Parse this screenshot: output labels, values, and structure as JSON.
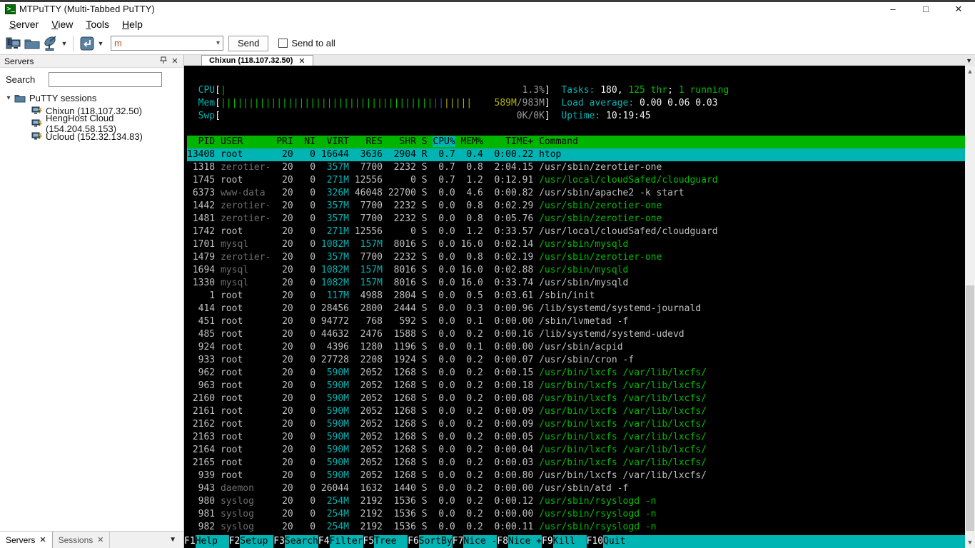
{
  "window": {
    "title": "MTPuTTY (Multi-Tabbed PuTTY)"
  },
  "menu": {
    "items": [
      "Server",
      "View",
      "Tools",
      "Help"
    ]
  },
  "toolbar": {
    "command_value": "m",
    "send_label": "Send",
    "send_to_all_label": "Send to all"
  },
  "sidebar": {
    "panel_title": "Servers",
    "search_label": "Search",
    "tree_root": "PuTTY sessions",
    "sessions": [
      "Chixun (118.107.32.50)",
      "HengHost Cloud (154.204.58.153)",
      "Ucloud (152.32.134.83)"
    ],
    "bottom_tabs": [
      "Servers",
      "Sessions"
    ]
  },
  "tabbar": {
    "active_tab": "Chixun (118.107.32.50)"
  },
  "terminal": {
    "colors": {
      "background": "#000000",
      "green": "#00b400",
      "cyan": "#00b4b4",
      "yellow": "#b4b400",
      "blue": "#4646dc",
      "text": "#c0c0c0",
      "dim_text": "#6e6e6e"
    },
    "cpu": {
      "label": "CPU",
      "ticks_green": 1,
      "pct": "1.3%"
    },
    "mem": {
      "label": "Mem",
      "ticks_green": 38,
      "ticks_blue": 2,
      "ticks_yellow": 5,
      "used": "589M",
      "total": "983M"
    },
    "swp": {
      "label": "Swp",
      "used": "0K",
      "total": "0K"
    },
    "tasks": {
      "label": "Tasks: ",
      "count": "180, ",
      "threads": "125 thr",
      "sep": "; ",
      "running": "1 running"
    },
    "load": {
      "label": "Load average: ",
      "values": "0.00 0.06 0.03"
    },
    "uptime": {
      "label": "Uptime: ",
      "value": "10:19:45"
    },
    "table": {
      "columns": [
        "PID",
        "USER",
        "PRI",
        "NI",
        "VIRT",
        "RES",
        "SHR",
        "S",
        "CPU%",
        "MEM%",
        "TIME+",
        "Command"
      ],
      "sort_column": "CPU%",
      "rows": [
        {
          "pid": "13408",
          "user": "root",
          "pri": "20",
          "ni": "0",
          "virt": "16644",
          "res": "3636",
          "shr": "2904",
          "s": "R",
          "cpu": "0.7",
          "mem": "0.4",
          "time": "0:00.22",
          "cmd": "htop",
          "selected": true,
          "thread": false
        },
        {
          "pid": "1318",
          "user": "zerotier-",
          "pri": "20",
          "ni": "0",
          "virt": "357M",
          "res": "7700",
          "shr": "2232",
          "s": "S",
          "cpu": "0.7",
          "mem": "0.8",
          "time": "2:04.15",
          "cmd": "/usr/sbin/zerotier-one",
          "thread": false
        },
        {
          "pid": "1745",
          "user": "root",
          "pri": "20",
          "ni": "0",
          "virt": "271M",
          "res": "12556",
          "shr": "0",
          "s": "S",
          "cpu": "0.7",
          "mem": "1.2",
          "time": "0:12.91",
          "cmd": "/usr/local/cloudSafed/cloudguard",
          "thread": true
        },
        {
          "pid": "6373",
          "user": "www-data",
          "pri": "20",
          "ni": "0",
          "virt": "326M",
          "res": "46048",
          "shr": "22700",
          "s": "S",
          "cpu": "0.0",
          "mem": "4.6",
          "time": "0:00.82",
          "cmd": "/usr/sbin/apache2 -k start",
          "thread": false
        },
        {
          "pid": "1442",
          "user": "zerotier-",
          "pri": "20",
          "ni": "0",
          "virt": "357M",
          "res": "7700",
          "shr": "2232",
          "s": "S",
          "cpu": "0.0",
          "mem": "0.8",
          "time": "0:02.29",
          "cmd": "/usr/sbin/zerotier-one",
          "thread": true
        },
        {
          "pid": "1481",
          "user": "zerotier-",
          "pri": "20",
          "ni": "0",
          "virt": "357M",
          "res": "7700",
          "shr": "2232",
          "s": "S",
          "cpu": "0.0",
          "mem": "0.8",
          "time": "0:05.76",
          "cmd": "/usr/sbin/zerotier-one",
          "thread": true
        },
        {
          "pid": "1742",
          "user": "root",
          "pri": "20",
          "ni": "0",
          "virt": "271M",
          "res": "12556",
          "shr": "0",
          "s": "S",
          "cpu": "0.0",
          "mem": "1.2",
          "time": "0:33.57",
          "cmd": "/usr/local/cloudSafed/cloudguard",
          "thread": false
        },
        {
          "pid": "1701",
          "user": "mysql",
          "pri": "20",
          "ni": "0",
          "virt": "1082M",
          "res": "157M",
          "shr": "8016",
          "s": "S",
          "cpu": "0.0",
          "mem": "16.0",
          "time": "0:02.14",
          "cmd": "/usr/sbin/mysqld",
          "thread": true
        },
        {
          "pid": "1479",
          "user": "zerotier-",
          "pri": "20",
          "ni": "0",
          "virt": "357M",
          "res": "7700",
          "shr": "2232",
          "s": "S",
          "cpu": "0.0",
          "mem": "0.8",
          "time": "0:02.19",
          "cmd": "/usr/sbin/zerotier-one",
          "thread": true
        },
        {
          "pid": "1694",
          "user": "mysql",
          "pri": "20",
          "ni": "0",
          "virt": "1082M",
          "res": "157M",
          "shr": "8016",
          "s": "S",
          "cpu": "0.0",
          "mem": "16.0",
          "time": "0:02.88",
          "cmd": "/usr/sbin/mysqld",
          "thread": true
        },
        {
          "pid": "1330",
          "user": "mysql",
          "pri": "20",
          "ni": "0",
          "virt": "1082M",
          "res": "157M",
          "shr": "8016",
          "s": "S",
          "cpu": "0.0",
          "mem": "16.0",
          "time": "0:33.74",
          "cmd": "/usr/sbin/mysqld",
          "thread": false
        },
        {
          "pid": "1",
          "user": "root",
          "pri": "20",
          "ni": "0",
          "virt": "117M",
          "res": "4988",
          "shr": "2804",
          "s": "S",
          "cpu": "0.0",
          "mem": "0.5",
          "time": "0:03.61",
          "cmd": "/sbin/init",
          "thread": false
        },
        {
          "pid": "414",
          "user": "root",
          "pri": "20",
          "ni": "0",
          "virt": "28456",
          "res": "2800",
          "shr": "2444",
          "s": "S",
          "cpu": "0.0",
          "mem": "0.3",
          "time": "0:00.96",
          "cmd": "/lib/systemd/systemd-journald",
          "thread": false
        },
        {
          "pid": "451",
          "user": "root",
          "pri": "20",
          "ni": "0",
          "virt": "94772",
          "res": "768",
          "shr": "592",
          "s": "S",
          "cpu": "0.0",
          "mem": "0.1",
          "time": "0:00.00",
          "cmd": "/sbin/lvmetad -f",
          "thread": false
        },
        {
          "pid": "485",
          "user": "root",
          "pri": "20",
          "ni": "0",
          "virt": "44632",
          "res": "2476",
          "shr": "1588",
          "s": "S",
          "cpu": "0.0",
          "mem": "0.2",
          "time": "0:00.16",
          "cmd": "/lib/systemd/systemd-udevd",
          "thread": false
        },
        {
          "pid": "924",
          "user": "root",
          "pri": "20",
          "ni": "0",
          "virt": "4396",
          "res": "1280",
          "shr": "1196",
          "s": "S",
          "cpu": "0.0",
          "mem": "0.1",
          "time": "0:00.00",
          "cmd": "/usr/sbin/acpid",
          "thread": false
        },
        {
          "pid": "933",
          "user": "root",
          "pri": "20",
          "ni": "0",
          "virt": "27728",
          "res": "2208",
          "shr": "1924",
          "s": "S",
          "cpu": "0.0",
          "mem": "0.2",
          "time": "0:00.07",
          "cmd": "/usr/sbin/cron -f",
          "thread": false
        },
        {
          "pid": "962",
          "user": "root",
          "pri": "20",
          "ni": "0",
          "virt": "590M",
          "res": "2052",
          "shr": "1268",
          "s": "S",
          "cpu": "0.0",
          "mem": "0.2",
          "time": "0:00.15",
          "cmd": "/usr/bin/lxcfs /var/lib/lxcfs/",
          "thread": true
        },
        {
          "pid": "963",
          "user": "root",
          "pri": "20",
          "ni": "0",
          "virt": "590M",
          "res": "2052",
          "shr": "1268",
          "s": "S",
          "cpu": "0.0",
          "mem": "0.2",
          "time": "0:00.18",
          "cmd": "/usr/bin/lxcfs /var/lib/lxcfs/",
          "thread": true
        },
        {
          "pid": "2160",
          "user": "root",
          "pri": "20",
          "ni": "0",
          "virt": "590M",
          "res": "2052",
          "shr": "1268",
          "s": "S",
          "cpu": "0.0",
          "mem": "0.2",
          "time": "0:00.08",
          "cmd": "/usr/bin/lxcfs /var/lib/lxcfs/",
          "thread": true
        },
        {
          "pid": "2161",
          "user": "root",
          "pri": "20",
          "ni": "0",
          "virt": "590M",
          "res": "2052",
          "shr": "1268",
          "s": "S",
          "cpu": "0.0",
          "mem": "0.2",
          "time": "0:00.09",
          "cmd": "/usr/bin/lxcfs /var/lib/lxcfs/",
          "thread": true
        },
        {
          "pid": "2162",
          "user": "root",
          "pri": "20",
          "ni": "0",
          "virt": "590M",
          "res": "2052",
          "shr": "1268",
          "s": "S",
          "cpu": "0.0",
          "mem": "0.2",
          "time": "0:00.09",
          "cmd": "/usr/bin/lxcfs /var/lib/lxcfs/",
          "thread": true
        },
        {
          "pid": "2163",
          "user": "root",
          "pri": "20",
          "ni": "0",
          "virt": "590M",
          "res": "2052",
          "shr": "1268",
          "s": "S",
          "cpu": "0.0",
          "mem": "0.2",
          "time": "0:00.05",
          "cmd": "/usr/bin/lxcfs /var/lib/lxcfs/",
          "thread": true
        },
        {
          "pid": "2164",
          "user": "root",
          "pri": "20",
          "ni": "0",
          "virt": "590M",
          "res": "2052",
          "shr": "1268",
          "s": "S",
          "cpu": "0.0",
          "mem": "0.2",
          "time": "0:00.04",
          "cmd": "/usr/bin/lxcfs /var/lib/lxcfs/",
          "thread": true
        },
        {
          "pid": "2165",
          "user": "root",
          "pri": "20",
          "ni": "0",
          "virt": "590M",
          "res": "2052",
          "shr": "1268",
          "s": "S",
          "cpu": "0.0",
          "mem": "0.2",
          "time": "0:00.03",
          "cmd": "/usr/bin/lxcfs /var/lib/lxcfs/",
          "thread": true
        },
        {
          "pid": "939",
          "user": "root",
          "pri": "20",
          "ni": "0",
          "virt": "590M",
          "res": "2052",
          "shr": "1268",
          "s": "S",
          "cpu": "0.0",
          "mem": "0.2",
          "time": "0:00.80",
          "cmd": "/usr/bin/lxcfs /var/lib/lxcfs/",
          "thread": false
        },
        {
          "pid": "943",
          "user": "daemon",
          "pri": "20",
          "ni": "0",
          "virt": "26044",
          "res": "1632",
          "shr": "1440",
          "s": "S",
          "cpu": "0.0",
          "mem": "0.2",
          "time": "0:00.00",
          "cmd": "/usr/sbin/atd -f",
          "thread": false
        },
        {
          "pid": "980",
          "user": "syslog",
          "pri": "20",
          "ni": "0",
          "virt": "254M",
          "res": "2192",
          "shr": "1536",
          "s": "S",
          "cpu": "0.0",
          "mem": "0.2",
          "time": "0:00.12",
          "cmd": "/usr/sbin/rsyslogd -n",
          "thread": true
        },
        {
          "pid": "981",
          "user": "syslog",
          "pri": "20",
          "ni": "0",
          "virt": "254M",
          "res": "2192",
          "shr": "1536",
          "s": "S",
          "cpu": "0.0",
          "mem": "0.2",
          "time": "0:00.00",
          "cmd": "/usr/sbin/rsyslogd -n",
          "thread": true
        },
        {
          "pid": "982",
          "user": "syslog",
          "pri": "20",
          "ni": "0",
          "virt": "254M",
          "res": "2192",
          "shr": "1536",
          "s": "S",
          "cpu": "0.0",
          "mem": "0.2",
          "time": "0:00.11",
          "cmd": "/usr/sbin/rsyslogd -n",
          "thread": true
        }
      ]
    },
    "fkeys": [
      {
        "key": "F1",
        "label": "Help"
      },
      {
        "key": "F2",
        "label": "Setup"
      },
      {
        "key": "F3",
        "label": "Search"
      },
      {
        "key": "F4",
        "label": "Filter"
      },
      {
        "key": "F5",
        "label": "Tree"
      },
      {
        "key": "F6",
        "label": "SortBy"
      },
      {
        "key": "F7",
        "label": "Nice -"
      },
      {
        "key": "F8",
        "label": "Nice +"
      },
      {
        "key": "F9",
        "label": "Kill"
      },
      {
        "key": "F10",
        "label": "Quit"
      }
    ]
  }
}
